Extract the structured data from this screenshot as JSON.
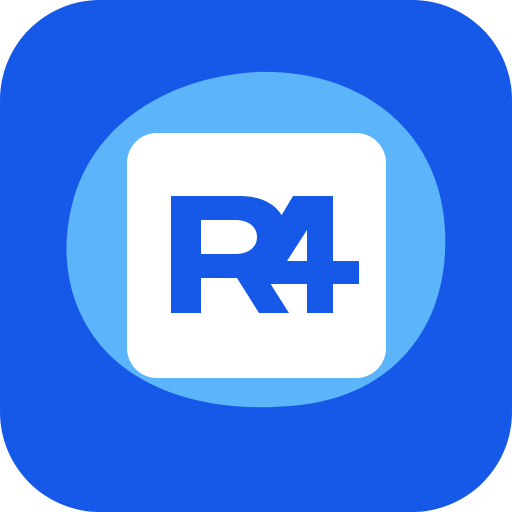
{
  "app_icon": {
    "logo_text": "R4",
    "colors": {
      "background": "#1658e8",
      "blob": "#5cb4fb",
      "tile": "#ffffff",
      "logo": "#1658e8"
    }
  }
}
